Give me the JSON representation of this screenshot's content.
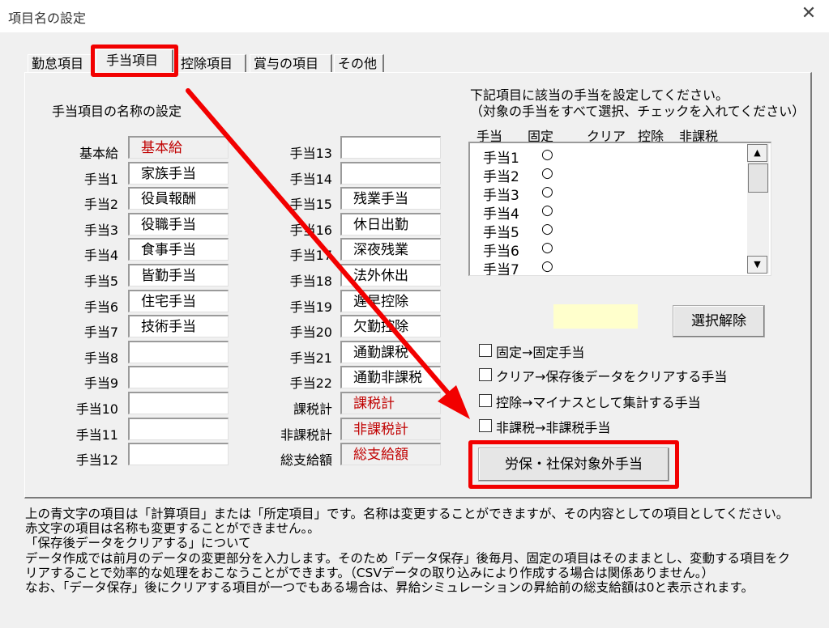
{
  "window": {
    "title": "項目名の設定",
    "close_symbol": "✕"
  },
  "tabs": [
    {
      "label": "勤怠項目"
    },
    {
      "label": "手当項目"
    },
    {
      "label": "控除項目"
    },
    {
      "label": "賞与の項目"
    },
    {
      "label": "その他"
    }
  ],
  "left_section": {
    "heading": "手当項目の名称の設定",
    "col1": [
      {
        "label": "基本給",
        "value": "基本給"
      },
      {
        "label": "手当1",
        "value": "家族手当"
      },
      {
        "label": "手当2",
        "value": "役員報酬"
      },
      {
        "label": "手当3",
        "value": "役職手当"
      },
      {
        "label": "手当4",
        "value": "食事手当"
      },
      {
        "label": "手当5",
        "value": "皆勤手当"
      },
      {
        "label": "手当6",
        "value": "住宅手当"
      },
      {
        "label": "手当7",
        "value": "技術手当"
      },
      {
        "label": "手当8",
        "value": ""
      },
      {
        "label": "手当9",
        "value": ""
      },
      {
        "label": "手当10",
        "value": ""
      },
      {
        "label": "手当11",
        "value": ""
      },
      {
        "label": "手当12",
        "value": ""
      }
    ],
    "col2": [
      {
        "label": "手当13",
        "value": ""
      },
      {
        "label": "手当14",
        "value": ""
      },
      {
        "label": "手当15",
        "value": "残業手当"
      },
      {
        "label": "手当16",
        "value": "休日出勤"
      },
      {
        "label": "手当17",
        "value": "深夜残業"
      },
      {
        "label": "手当18",
        "value": "法外休出"
      },
      {
        "label": "手当19",
        "value": "遅早控除"
      },
      {
        "label": "手当20",
        "value": "欠勤控除"
      },
      {
        "label": "手当21",
        "value": "通勤課税"
      },
      {
        "label": "手当22",
        "value": "通勤非課税"
      },
      {
        "label": "課税計",
        "value": "課税計"
      },
      {
        "label": "非課税計",
        "value": "非課税計"
      },
      {
        "label": "総支給額",
        "value": "総支給額"
      }
    ]
  },
  "right_section": {
    "instruction_line1": "下記項目に該当の手当を設定してください。",
    "instruction_line2": "（対象の手当をすべて選択、チェックを入れてください）",
    "columns": [
      "手当",
      "固定",
      "クリア",
      "控除",
      "非課税"
    ],
    "list": [
      {
        "name": "手当1",
        "mark": "○"
      },
      {
        "name": "手当2",
        "mark": "○"
      },
      {
        "name": "手当3",
        "mark": "○"
      },
      {
        "name": "手当4",
        "mark": "○"
      },
      {
        "name": "手当5",
        "mark": "○"
      },
      {
        "name": "手当6",
        "mark": "○"
      },
      {
        "name": "手当7",
        "mark": "○"
      }
    ],
    "deselect_button": "選択解除",
    "checkboxes": [
      {
        "label": "固定→固定手当",
        "checked": false
      },
      {
        "label": "クリア→保存後データをクリアする手当",
        "checked": false
      },
      {
        "label": "控除→マイナスとして集計する手当",
        "checked": false
      },
      {
        "label": "非課税→非課税手当",
        "checked": false
      }
    ],
    "labor_insurance_button": "労保・社保対象外手当",
    "highlight_color": "#ffffcc"
  },
  "notes": [
    "上の青文字の項目は「計算項目」または「所定項目」です。名称は変更することができますが、その内容としての項目としてください。",
    "赤文字の項目は名称も変更することができません。。",
    "「保存後データをクリアする」について",
    "データ作成では前月のデータの変更部分を入力します。そのため「データ保存」後毎月、固定の項目はそのままとし、変動する項目をク",
    "リアすることで効率的な処理をおこなうことができます。（CSVデータの取り込みにより作成する場合は関係ありません。）",
    "なお、「データ保存」後にクリアする項目が一つでもある場合は、昇給シミュレーションの昇給前の総支給額は0と表示されます。"
  ],
  "annotation_color": "#f20000"
}
